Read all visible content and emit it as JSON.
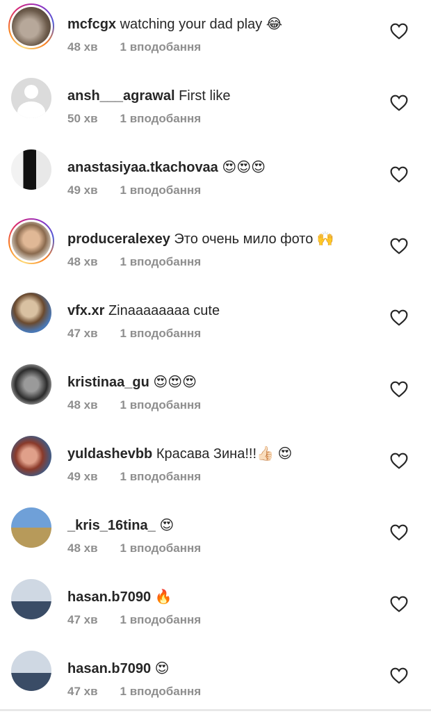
{
  "comments": [
    {
      "username": "mcfcgx",
      "text": "watching your dad play 😂",
      "time": "48 хв",
      "likes": "1 вподобання",
      "story": true,
      "avatar_colors": [
        "#6b5a4a",
        "#b7a89a"
      ]
    },
    {
      "username": "ansh___agrawal",
      "text": "First like",
      "time": "50 хв",
      "likes": "1 вподобання",
      "story": false,
      "avatar_colors": [
        "#dbdbdb",
        "#ffffff"
      ]
    },
    {
      "username": "anastasiyaa.tkachovaa",
      "text": "😍😍😍",
      "time": "49 хв",
      "likes": "1 вподобання",
      "story": false,
      "avatar_colors": [
        "#111111",
        "#e8e8e8"
      ]
    },
    {
      "username": "produceralexey",
      "text": "Это очень мило фото 🙌",
      "time": "48 хв",
      "likes": "1 вподобання",
      "story": true,
      "avatar_colors": [
        "#8a6a4e",
        "#c9a98a"
      ]
    },
    {
      "username": "vfx.xr",
      "text": "Zinaaaaaaaa cute",
      "time": "47 хв",
      "likes": "1 вподобання",
      "story": false,
      "avatar_colors": [
        "#4a78b5",
        "#d9c1a2"
      ]
    },
    {
      "username": "kristinaa_gu",
      "text": "😍😍😍",
      "time": "48 хв",
      "likes": "1 вподобання",
      "story": false,
      "avatar_colors": [
        "#2b2b2b",
        "#9a9a9a"
      ]
    },
    {
      "username": "yuldashevbb",
      "text": "Красава Зина!!!👍🏻 😍",
      "time": "49 хв",
      "likes": "1 вподобання",
      "story": false,
      "avatar_colors": [
        "#3b5d8a",
        "#e0a08a"
      ]
    },
    {
      "username": "_kris_16tina_",
      "text": "😍",
      "time": "48 хв",
      "likes": "1 вподобання",
      "story": false,
      "avatar_colors": [
        "#6fa0d8",
        "#b79a5a"
      ]
    },
    {
      "username": "hasan.b7090",
      "text": "🔥",
      "time": "47 хв",
      "likes": "1 вподобання",
      "story": false,
      "avatar_colors": [
        "#cfd8e3",
        "#3a4c66"
      ]
    },
    {
      "username": "hasan.b7090",
      "text": "😍",
      "time": "47 хв",
      "likes": "1 вподобання",
      "story": false,
      "avatar_colors": [
        "#cfd8e3",
        "#3a4c66"
      ]
    }
  ]
}
